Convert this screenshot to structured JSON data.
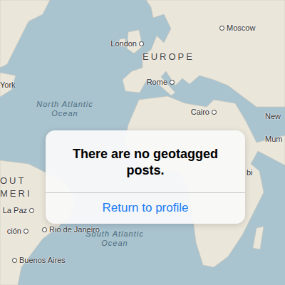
{
  "map": {
    "labels": [
      {
        "text": "Moscow",
        "kind": "city"
      },
      {
        "text": "London",
        "kind": "city"
      },
      {
        "text": "EUROPE",
        "kind": "region"
      },
      {
        "text": "Rome",
        "kind": "city"
      },
      {
        "text": "York",
        "kind": "city"
      },
      {
        "text": "North Atlantic Ocean",
        "kind": "ocean"
      },
      {
        "text": "Cairo",
        "kind": "city"
      },
      {
        "text": "New",
        "kind": "city"
      },
      {
        "text": "Mum",
        "kind": "city"
      },
      {
        "text": "bi",
        "kind": "city"
      },
      {
        "text": "OUT",
        "kind": "region"
      },
      {
        "text": "MERI",
        "kind": "region"
      },
      {
        "text": "La Paz",
        "kind": "city"
      },
      {
        "text": "ción",
        "kind": "city"
      },
      {
        "text": "Rio de Janeiro",
        "kind": "city"
      },
      {
        "text": "South Atlantic Ocean",
        "kind": "ocean"
      },
      {
        "text": "Buenos Aires",
        "kind": "city"
      }
    ]
  },
  "alert": {
    "message": "There are no geotagged posts.",
    "button": "Return to profile"
  }
}
